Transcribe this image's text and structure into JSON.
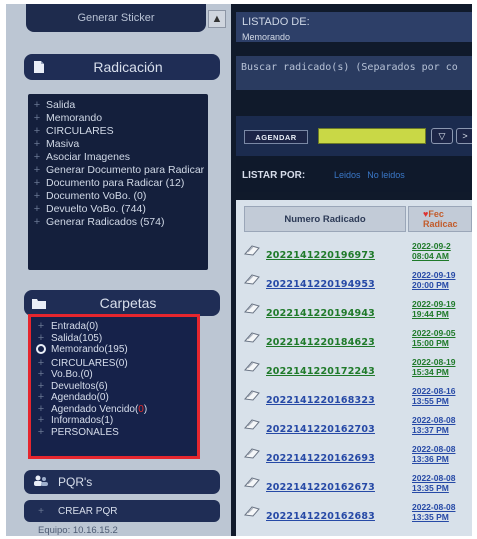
{
  "sidebar": {
    "top_button": "Generar Sticker",
    "radicacion": {
      "title": "Radicación",
      "items": [
        "Salida",
        "Memorando",
        "CIRCULARES",
        "Masiva",
        "Asociar Imagenes",
        "Generar Documento para Radicar",
        "Documento para Radicar (12)",
        "Documento VoBo. (0)",
        "Devuelto VoBo. (744)",
        "Generar Radicados (574)"
      ]
    },
    "carpetas": {
      "title": "Carpetas",
      "items": [
        {
          "label": "Entrada(0)",
          "icon": "plus"
        },
        {
          "label": "Salida(105)",
          "icon": "plus"
        },
        {
          "label": "Memorando(195)",
          "icon": "open"
        },
        {
          "label": "CIRCULARES(0)",
          "icon": "plus"
        },
        {
          "label": "Vo.Bo.(0)",
          "icon": "plus"
        },
        {
          "label": "Devueltos(6)",
          "icon": "plus"
        },
        {
          "label": "Agendado(0)",
          "icon": "plus"
        },
        {
          "label": "Agendado Vencido(",
          "count": "0",
          "after": ")",
          "icon": "plus"
        },
        {
          "label": "Informados(1)",
          "icon": "plus"
        },
        {
          "label": "PERSONALES",
          "icon": "plus"
        }
      ]
    },
    "pqr": "PQR's",
    "crear_pqr": "CREAR PQR",
    "equipo": "Equipo: 10.16.15.2"
  },
  "main": {
    "listado_title": "LISTADO DE:",
    "listado_sub": "Memorando",
    "search_placeholder": "Buscar radicado(s) (Separados por co",
    "agendar_label": "AGENDAR",
    "agendar_drop": "▽",
    "agendar_next": ">",
    "listar_label": "LISTAR POR:",
    "listar_link1": "Leidos",
    "listar_link2": "No leidos",
    "col_numero": "Numero Radicado",
    "col_fecha": "Fec\nRadicac",
    "rows": [
      {
        "num": "2022141220196973",
        "date1": "2022-09-2",
        "date2": "08:04 AM"
      },
      {
        "num": "2022141220194953",
        "date1": "2022-09-19",
        "date2": "20:00 PM"
      },
      {
        "num": "2022141220194943",
        "date1": "2022-09-19",
        "date2": "19:44 PM"
      },
      {
        "num": "2022141220184623",
        "date1": "2022-09-05",
        "date2": "15:00 PM"
      },
      {
        "num": "2022141220172243",
        "date1": "2022-08-19",
        "date2": "15:34 PM"
      },
      {
        "num": "2022141220168323",
        "date1": "2022-08-16",
        "date2": "13:55 PM"
      },
      {
        "num": "2022141220162703",
        "date1": "2022-08-08",
        "date2": "13:37 PM"
      },
      {
        "num": "2022141220162693",
        "date1": "2022-08-08",
        "date2": "13:36 PM"
      },
      {
        "num": "2022141220162673",
        "date1": "2022-08-08",
        "date2": "13:35 PM"
      },
      {
        "num": "2022141220162683",
        "date1": "2022-08-08",
        "date2": "13:35 PM"
      }
    ]
  },
  "colors": {
    "link_green": "#1f7a2a",
    "link_blue": "#2649a6",
    "highlight_red": "#e5262e"
  }
}
